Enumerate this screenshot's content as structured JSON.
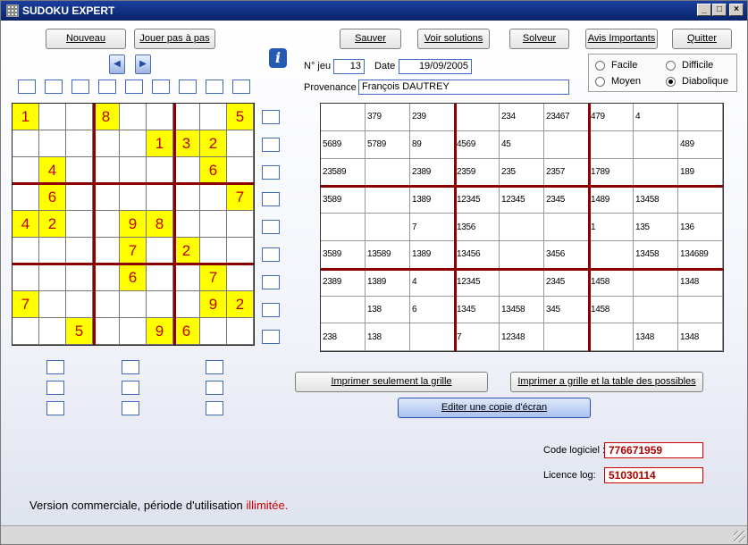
{
  "window": {
    "title": "SUDOKU EXPERT"
  },
  "toolbar": {
    "nouveau": "Nouveau",
    "jouer": "Jouer pas à pas",
    "sauver": "Sauver",
    "voir_solutions": "Voir solutions",
    "solveur": "Solveur",
    "avis": "Avis Importants",
    "quitter": "Quitter"
  },
  "game": {
    "num_label": "N° jeu",
    "num_value": "13",
    "date_label": "Date",
    "date_value": "19/09/2005",
    "provenance_label": "Provenance",
    "provenance_value": "François DAUTREY"
  },
  "difficulty": {
    "options": [
      "Facile",
      "Difficile",
      "Moyen",
      "Diabolique"
    ],
    "selected": "Diabolique"
  },
  "sudoku_grid": [
    [
      "1",
      "",
      "",
      "8",
      "",
      "",
      "",
      "",
      "5"
    ],
    [
      "",
      "",
      "",
      "",
      "",
      "1",
      "3",
      "2",
      ""
    ],
    [
      "",
      "4",
      "",
      "",
      "",
      "",
      "",
      "6",
      ""
    ],
    [
      "",
      "6",
      "",
      "",
      "",
      "",
      "",
      "",
      "7"
    ],
    [
      "4",
      "2",
      "",
      "",
      "9",
      "8",
      "",
      "",
      ""
    ],
    [
      "",
      "",
      "",
      "",
      "7",
      "",
      "2",
      "",
      ""
    ],
    [
      "",
      "",
      "",
      "",
      "6",
      "",
      "",
      "7",
      ""
    ],
    [
      "7",
      "",
      "",
      "",
      "",
      "",
      "",
      "9",
      "2"
    ],
    [
      "",
      "",
      "5",
      "",
      "",
      "9",
      "6",
      "",
      ""
    ]
  ],
  "candidates_grid": [
    [
      "",
      "379",
      "239",
      "",
      "234",
      "23467",
      "479",
      "4",
      ""
    ],
    [
      "5689",
      "5789",
      "89",
      "4569",
      "45",
      "",
      "",
      "",
      "489"
    ],
    [
      "23589",
      "",
      "2389",
      "2359",
      "235",
      "2357",
      "1789",
      "",
      "189"
    ],
    [
      "3589",
      "",
      "1389",
      "12345",
      "12345",
      "2345",
      "1489",
      "13458",
      ""
    ],
    [
      "",
      "",
      "7",
      "1356",
      "",
      "",
      "1",
      "135",
      "136"
    ],
    [
      "3589",
      "13589",
      "1389",
      "13456",
      "",
      "3456",
      "",
      "13458",
      "134689"
    ],
    [
      "2389",
      "1389",
      "4",
      "12345",
      "",
      "2345",
      "1458",
      "",
      "1348"
    ],
    [
      "",
      "138",
      "6",
      "1345",
      "13458",
      "345",
      "1458",
      "",
      ""
    ],
    [
      "238",
      "138",
      "",
      "7",
      "12348",
      "",
      "",
      "1348",
      "1348"
    ]
  ],
  "print": {
    "grille": "Imprimer seulement la grille",
    "grille_table": "Imprimer a grille et la table des possibles",
    "copie": "Editer une copie d'écran"
  },
  "codes": {
    "logiciel_label": "Code logiciel :",
    "logiciel_value": "776671959",
    "licence_label": "Licence log:",
    "licence_value": "51030114"
  },
  "footer": {
    "text": "Version commerciale, période d'utilisation ",
    "highlight": "illimitée."
  },
  "colors": {
    "given_bg": "#ffff00",
    "digit": "#c00000",
    "block_line": "#8b0000",
    "code_text": "#b00000"
  },
  "icons": [
    "app-grid-icon",
    "minimize-icon",
    "maximize-icon",
    "close-icon",
    "arrow-left-icon",
    "arrow-right-icon",
    "info-icon"
  ]
}
